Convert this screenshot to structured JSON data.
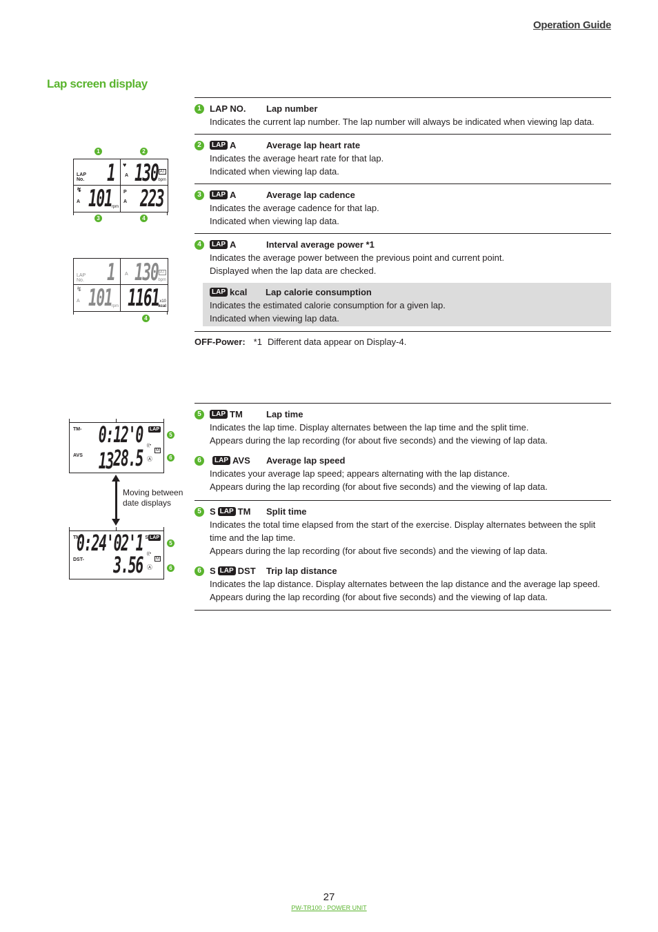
{
  "header": {
    "title": "Operation Guide"
  },
  "section_title": "Lap screen display",
  "lcd_top": {
    "callouts": [
      "1",
      "2",
      "3",
      "4"
    ],
    "cells": [
      {
        "label_top": "LAP",
        "label_bottom": "No.",
        "value": "1"
      },
      {
        "icon": "heart-icon",
        "label": "A",
        "value": "130",
        "badge": "AT",
        "unit": "bpm"
      },
      {
        "icon": "cadence-icon",
        "label": "A",
        "value": "101",
        "unit": "rpm"
      },
      {
        "label_top": "P",
        "label_bottom": "A",
        "value": "223"
      }
    ]
  },
  "lcd_kcal": {
    "callout": "4",
    "cells": [
      {
        "label_top": "LAP",
        "label_bottom": "No.",
        "value": "1"
      },
      {
        "label": "A",
        "value": "130",
        "badge": "AT",
        "unit": "bpm"
      },
      {
        "icon": "cadence-icon",
        "label": "A",
        "value": "101",
        "unit": "rpm"
      },
      {
        "value": "1161",
        "unit_top": "x10",
        "unit": "kcal"
      }
    ]
  },
  "items_top": [
    {
      "num": "1",
      "code": "LAP NO.",
      "lap_badge": false,
      "title": "Lap number",
      "lines": [
        "Indicates the current lap number. The lap number will always be indicated when viewing lap data."
      ]
    },
    {
      "num": "2",
      "code": "A",
      "lap_badge": true,
      "title": "Average lap heart rate",
      "lines": [
        "Indicates the average heart rate for that lap.",
        "Indicated when viewing lap data."
      ]
    },
    {
      "num": "3",
      "code": "A",
      "lap_badge": true,
      "title": "Average lap cadence",
      "lines": [
        "Indicates the average cadence for that lap.",
        "Indicated when viewing lap data."
      ]
    },
    {
      "num": "4",
      "code": "A",
      "lap_badge": true,
      "title": "Interval average power *1",
      "lines": [
        "Indicates the average power between the previous point and current point.",
        "Displayed when the lap data are checked."
      ],
      "sub": {
        "code": "kcal",
        "lap_badge": true,
        "title": "Lap calorie consumption",
        "lines": [
          "Indicates the estimated calorie consumption for a given lap.",
          "Indicated when viewing lap data."
        ]
      }
    }
  ],
  "note": {
    "label": "OFF-Power:",
    "marker": "*1",
    "text": "Different data appear on Display-4."
  },
  "lcd_lap": {
    "row1_label": "TM-",
    "row1_value": "0:12'0 13",
    "row1_badge": "LAP",
    "row2_label": "AVS",
    "row2_value": "28.5",
    "row2_badge": "M",
    "callouts": [
      "5",
      "6"
    ]
  },
  "move_label": [
    "Moving between",
    "date displays"
  ],
  "lcd_split": {
    "row1_label": "TM-",
    "row1_value": "0:24'02'1",
    "row1_prefix": "S",
    "row1_badge": "LAP",
    "row2_label": "DST-",
    "row2_value": "3.56",
    "row2_badge": "M",
    "callouts": [
      "5",
      "6"
    ]
  },
  "items_bottom_a": [
    {
      "num": "5",
      "prefix": "",
      "code": "TM",
      "title": "Lap time",
      "lines": [
        "Indicates the lap time. Display alternates between the lap time and the split time.",
        "Appears during the lap recording (for about five seconds) and the viewing of lap data."
      ]
    },
    {
      "num": "6",
      "prefix": "",
      "code": "AVS",
      "title": "Average lap speed",
      "lines": [
        "Indicates your average lap speed; appears alternating with the lap distance.",
        "Appears during the lap recording (for about five seconds) and the viewing of lap data."
      ]
    }
  ],
  "items_bottom_b": [
    {
      "num": "5",
      "prefix": "S",
      "code": "TM",
      "title": "Split time",
      "lines": [
        "Indicates the total time elapsed from the start of the exercise. Display alternates between the split time and the lap time.",
        "Appears during the lap recording (for about five seconds) and the viewing of lap data."
      ]
    },
    {
      "num": "6",
      "prefix": "S",
      "code": "DST",
      "title": "Trip lap distance",
      "lines": [
        "Indicates the lap distance. Display alternates between the lap distance and the average lap speed.",
        "Appears during the lap recording (for about five seconds) and the viewing of lap data."
      ]
    }
  ],
  "lap_badge_text": "LAP",
  "footer": {
    "page_number": "27",
    "product": "PW-TR100 : POWER UNIT"
  },
  "colors": {
    "accent": "#5ab42e",
    "text": "#231f20",
    "highlight_bg": "#dcdcdc"
  }
}
